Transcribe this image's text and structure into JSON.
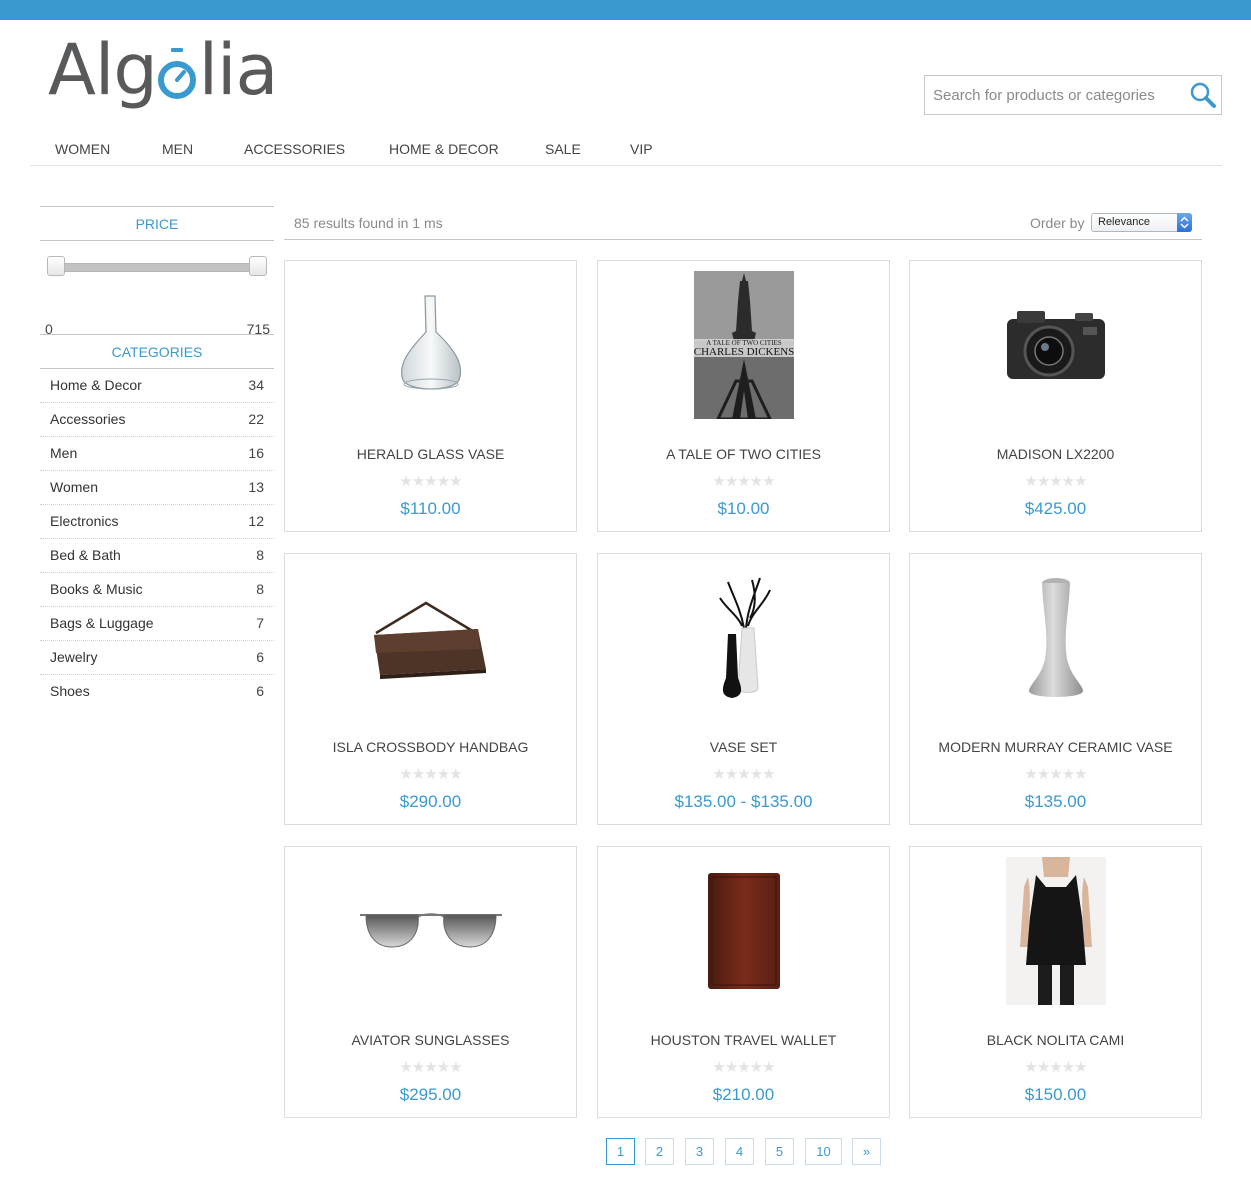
{
  "brand": {
    "logo_text_left": "Alg",
    "logo_text_o": "o",
    "logo_text_right": "lia",
    "accent_color": "#3a9ad0"
  },
  "search": {
    "placeholder": "Search for products or categories",
    "value": "",
    "icon": "search-icon"
  },
  "nav": [
    "WOMEN",
    "MEN",
    "ACCESSORIES",
    "HOME & DECOR",
    "SALE",
    "VIP"
  ],
  "facets": {
    "price": {
      "title": "PRICE",
      "min": "0",
      "max": "715"
    },
    "categories": {
      "title": "CATEGORIES",
      "items": [
        {
          "label": "Home & Decor",
          "count": "34"
        },
        {
          "label": "Accessories",
          "count": "22"
        },
        {
          "label": "Men",
          "count": "16"
        },
        {
          "label": "Women",
          "count": "13"
        },
        {
          "label": "Electronics",
          "count": "12"
        },
        {
          "label": "Bed & Bath",
          "count": "8"
        },
        {
          "label": "Books & Music",
          "count": "8"
        },
        {
          "label": "Bags & Luggage",
          "count": "7"
        },
        {
          "label": "Jewelry",
          "count": "6"
        },
        {
          "label": "Shoes",
          "count": "6"
        }
      ]
    }
  },
  "results": {
    "summary": "85 results found in 1 ms",
    "order_label": "Order by",
    "order_selected": "Relevance"
  },
  "products": [
    {
      "name": "HERALD GLASS VASE",
      "stars": "★★★★★",
      "price": "$110.00",
      "image": "glass-vase"
    },
    {
      "name": "A TALE OF TWO CITIES",
      "stars": "★★★★★",
      "price": "$10.00",
      "image": "book-cover",
      "image_text_1": "A TALE OF TWO CITIES",
      "image_text_2": "CHARLES DICKENS"
    },
    {
      "name": "MADISON LX2200",
      "stars": "★★★★★",
      "price": "$425.00",
      "image": "camera"
    },
    {
      "name": "ISLA CROSSBODY HANDBAG",
      "stars": "★★★★★",
      "price": "$290.00",
      "image": "handbag"
    },
    {
      "name": "VASE SET",
      "stars": "★★★★★",
      "price": "$135.00 - $135.00",
      "image": "vase-set"
    },
    {
      "name": "MODERN MURRAY CERAMIC VASE",
      "stars": "★★★★★",
      "price": "$135.00",
      "image": "ceramic-vase"
    },
    {
      "name": "AVIATOR SUNGLASSES",
      "stars": "★★★★★",
      "price": "$295.00",
      "image": "sunglasses"
    },
    {
      "name": "HOUSTON TRAVEL WALLET",
      "stars": "★★★★★",
      "price": "$210.00",
      "image": "wallet"
    },
    {
      "name": "BLACK NOLITA CAMI",
      "stars": "★★★★★",
      "price": "$150.00",
      "image": "cami-top"
    }
  ],
  "pagination": {
    "pages": [
      "1",
      "2",
      "3",
      "4",
      "5",
      "10",
      "»"
    ],
    "current": "1"
  }
}
